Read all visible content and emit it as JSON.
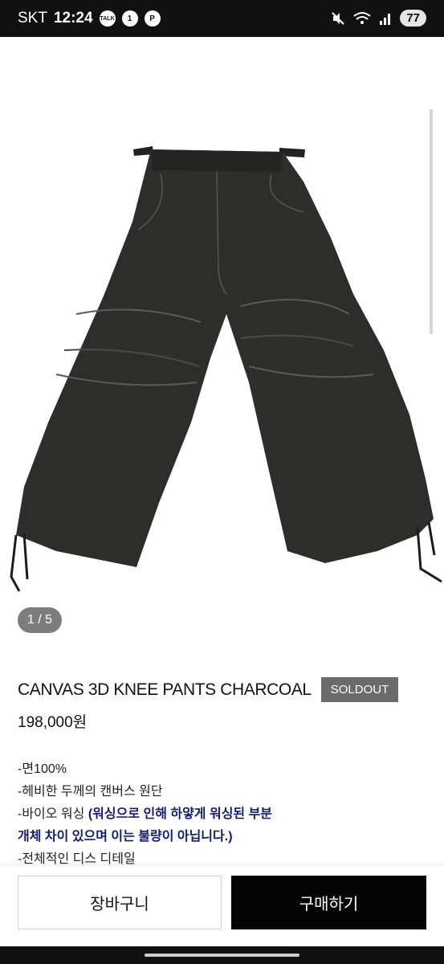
{
  "status_bar": {
    "carrier": "SKT",
    "time": "12:24",
    "talk_icon": "TALK",
    "notification_count": "1",
    "pinterest_icon": "P",
    "battery": "77"
  },
  "gallery": {
    "counter": "1 / 5"
  },
  "product": {
    "title": "CANVAS 3D KNEE PANTS CHARCOAL",
    "badge": "SOLDOUT",
    "price": "198,000원",
    "description": {
      "line1": "-면100%",
      "line2": "-헤비한 두께의 캔버스 원단",
      "line3_prefix": "-바이오 워싱 ",
      "line3_highlight": "(워싱으로 인해 하얗게 워싱된 부분",
      "line4_highlight": "개체 차이 있으며 이는 불량이 아닙니다.)",
      "line5": "-전체적인 디스 디테일"
    }
  },
  "actions": {
    "cart_label": "장바구니",
    "buy_label": "구매하기"
  },
  "colors": {
    "highlight": "#141c6b",
    "soldout_badge": "#6b6b6b",
    "buy_button": "#050505"
  }
}
